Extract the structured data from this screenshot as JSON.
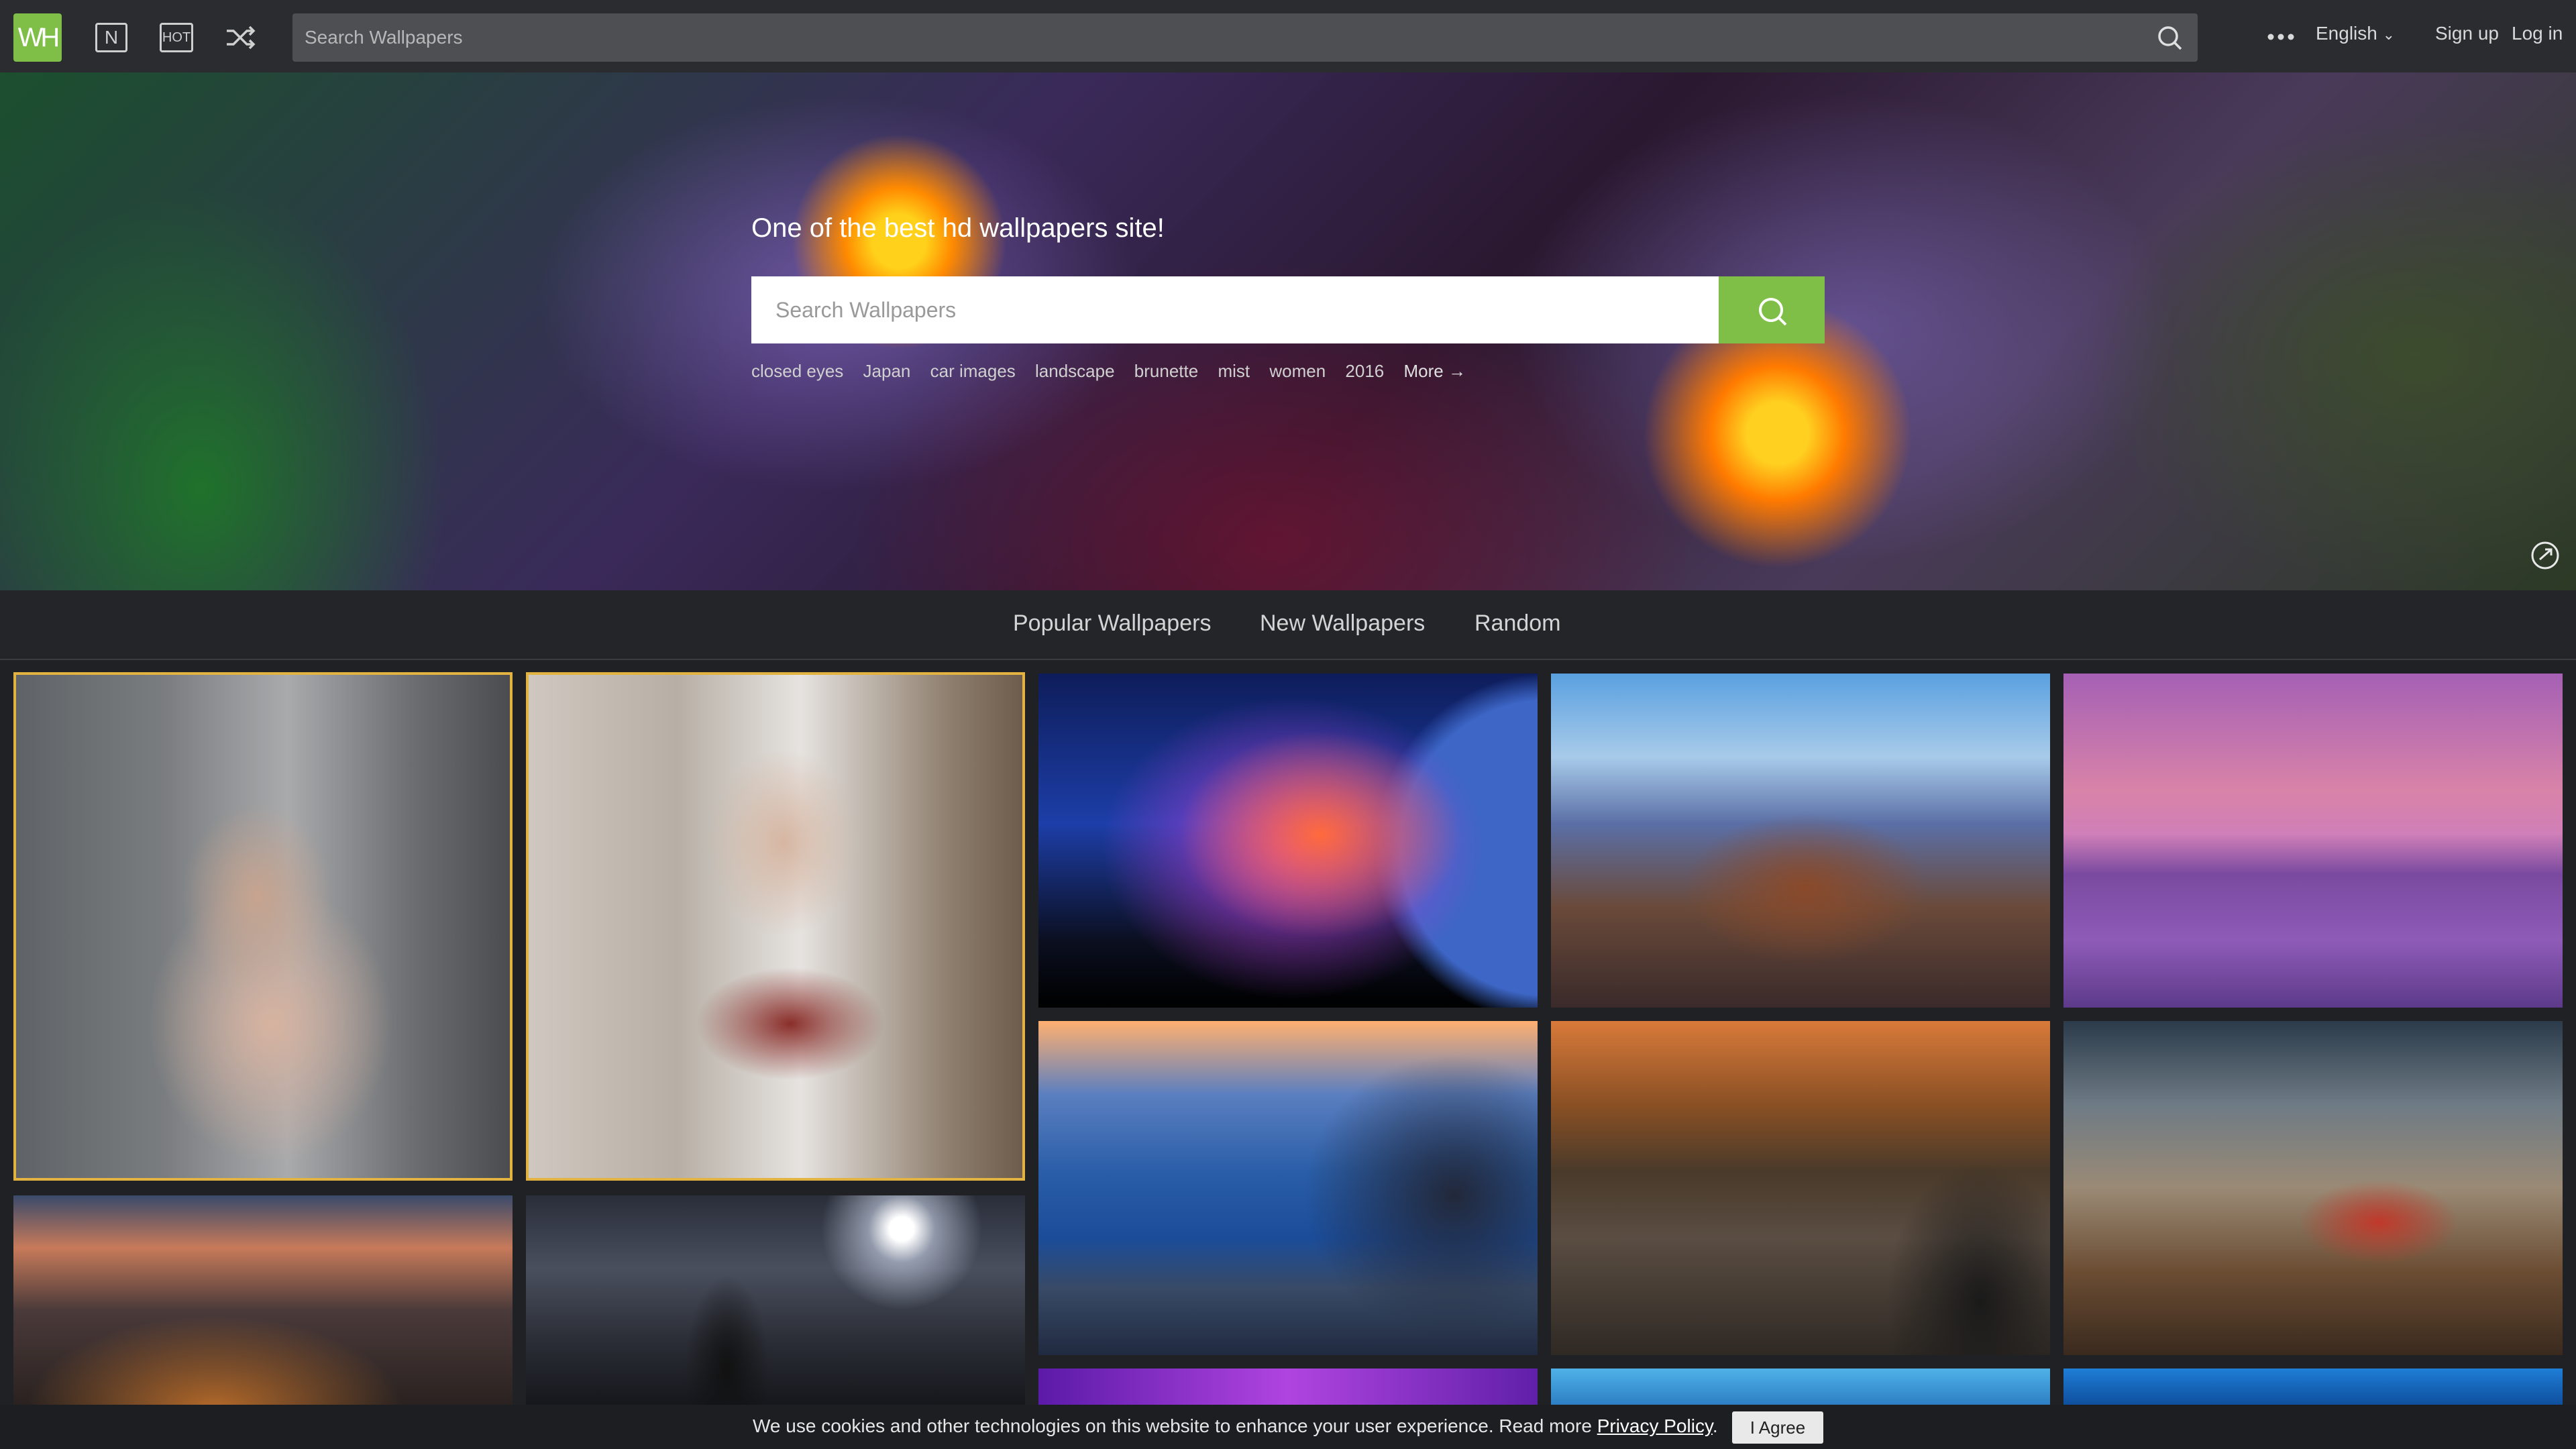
{
  "header": {
    "logo_text": "WH",
    "new_icon_text": "N",
    "hot_icon_text": "HOT",
    "search_placeholder": "Search Wallpapers",
    "language": "English",
    "signup": "Sign up",
    "login": "Log in",
    "accent_color": "#7fbf47"
  },
  "hero": {
    "title": "One of the best hd wallpapers site!",
    "search_placeholder": "Search Wallpapers",
    "tags": [
      "closed eyes",
      "Japan",
      "car images",
      "landscape",
      "brunette",
      "mist",
      "women",
      "2016"
    ],
    "more": "More →"
  },
  "tabs": [
    "Popular Wallpapers",
    "New Wallpapers",
    "Random"
  ],
  "grid": {
    "tiles": [
      {
        "name": "wallpaper-woman-gray-hoodie",
        "selected": true
      },
      {
        "name": "wallpaper-woman-gray-kimono",
        "selected": true
      },
      {
        "name": "wallpaper-space-nebula-planet",
        "selected": false
      },
      {
        "name": "wallpaper-anime-japanese-town",
        "selected": false
      },
      {
        "name": "wallpaper-purple-lake-sunset",
        "selected": false
      },
      {
        "name": "wallpaper-blue-coast-rocks",
        "selected": false
      },
      {
        "name": "wallpaper-railway-forest",
        "selected": false
      },
      {
        "name": "wallpaper-red-car-mountains",
        "selected": false
      },
      {
        "name": "wallpaper-city-dusk",
        "selected": false
      },
      {
        "name": "wallpaper-masked-woman-moon",
        "selected": false
      }
    ],
    "selected_border_color": "#e3b341"
  },
  "cookie": {
    "text": "We use cookies and other technologies on this website to enhance your user experience. Read more ",
    "link": "Privacy Policy",
    "period": ".",
    "button": "I Agree"
  }
}
